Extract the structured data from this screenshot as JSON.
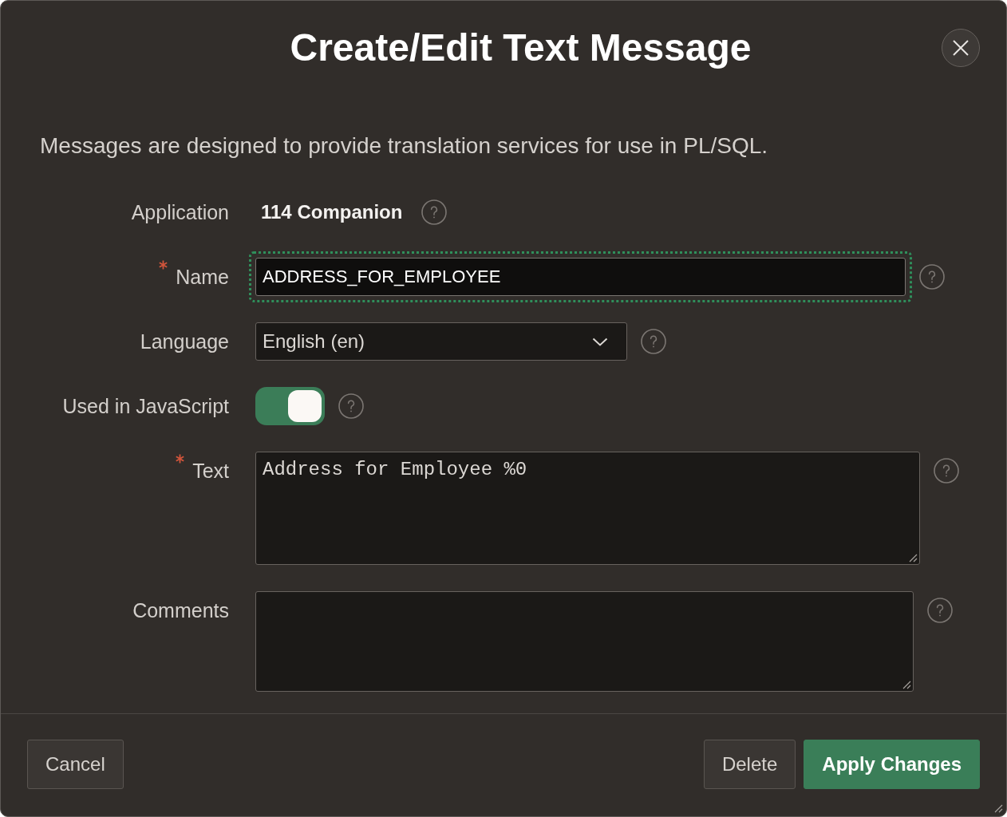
{
  "dialog": {
    "title": "Create/Edit Text Message"
  },
  "description": "Messages are designed to provide translation services for use in PL/SQL.",
  "fields": [
    {
      "kind": "display",
      "label": "Application",
      "required": false,
      "focused": false,
      "value": "114 Companion"
    },
    {
      "kind": "text",
      "label": "Name",
      "required": true,
      "focused": true,
      "value": "ADDRESS_FOR_EMPLOYEE"
    },
    {
      "kind": "select",
      "label": "Language",
      "required": false,
      "focused": false,
      "value": "English (en)"
    },
    {
      "kind": "switch",
      "label": "Used in JavaScript",
      "required": false,
      "focused": false,
      "on": true
    },
    {
      "kind": "textarea",
      "label": "Text",
      "required": true,
      "focused": false,
      "value": "Address for Employee %0"
    },
    {
      "kind": "textarea",
      "label": "Comments",
      "required": false,
      "focused": false
    }
  ],
  "footer": {
    "left_buttons": [
      {
        "label": "Cancel",
        "kind": "secondary"
      }
    ],
    "right_buttons": [
      {
        "label": "Delete",
        "kind": "secondary"
      },
      {
        "label": "Apply Changes",
        "kind": "primary"
      }
    ]
  }
}
